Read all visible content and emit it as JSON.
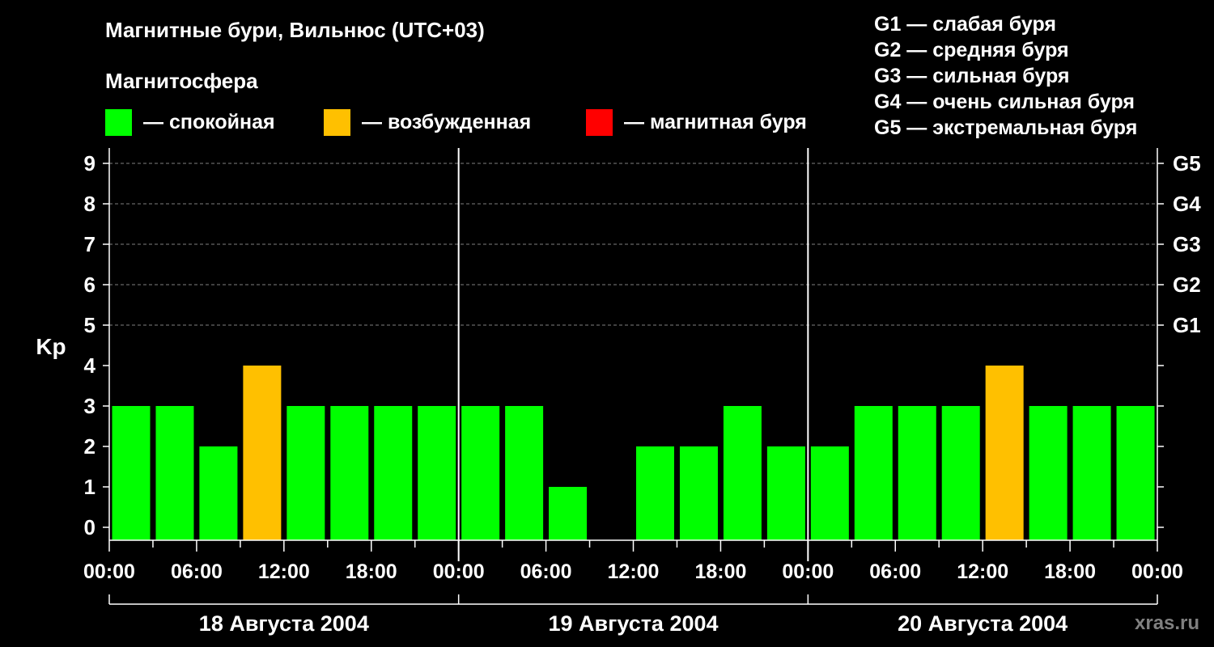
{
  "title": "Магнитные бури, Вильнюс (UTC+03)",
  "magnetosphere_heading": "Магнитосфера",
  "legend": [
    {
      "label": "— спокойная",
      "color": "#00ff00"
    },
    {
      "label": "— возбужденная",
      "color": "#ffc000"
    },
    {
      "label": "— магнитная буря",
      "color": "#ff0000"
    }
  ],
  "g_scale": [
    "G1 — слабая буря",
    "G2 — средняя буря",
    "G3 — сильная буря",
    "G4 — очень сильная буря",
    "G5 — экстремальная буря"
  ],
  "watermark": "xras.ru",
  "chart_data": {
    "type": "bar",
    "ylabel": "Kp",
    "ylim": [
      0,
      9
    ],
    "y_ticks": [
      "0",
      "1",
      "2",
      "3",
      "4",
      "5",
      "6",
      "7",
      "8",
      "9"
    ],
    "right_ticks": [
      {
        "kp": 5,
        "label": "G1"
      },
      {
        "kp": 6,
        "label": "G2"
      },
      {
        "kp": 7,
        "label": "G3"
      },
      {
        "kp": 8,
        "label": "G4"
      },
      {
        "kp": 9,
        "label": "G5"
      }
    ],
    "x_tick_labels": [
      "00:00",
      "06:00",
      "12:00",
      "18:00",
      "00:00",
      "06:00",
      "12:00",
      "18:00",
      "00:00",
      "06:00",
      "12:00",
      "18:00",
      "00:00"
    ],
    "days": [
      "18 Августа 2004",
      "19 Августа 2004",
      "20 Августа 2004"
    ],
    "bar_interval_hours": 3,
    "values": [
      3,
      3,
      2,
      4,
      3,
      3,
      3,
      3,
      3,
      3,
      1,
      0,
      2,
      2,
      3,
      2,
      2,
      3,
      3,
      3,
      4,
      3,
      3,
      3
    ],
    "colors": {
      "quiet": "#00ff00",
      "active": "#ffc000",
      "storm": "#ff0000"
    },
    "grid": true
  }
}
